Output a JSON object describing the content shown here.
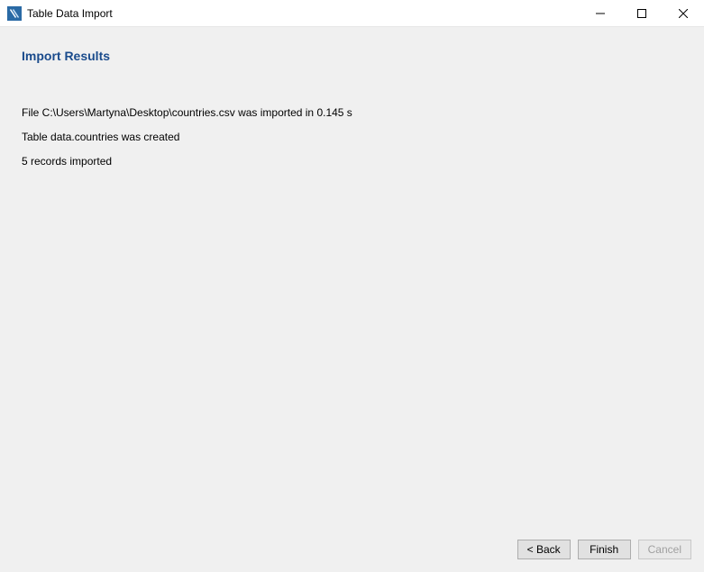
{
  "window": {
    "title": "Table Data Import"
  },
  "page": {
    "heading": "Import Results"
  },
  "results": {
    "line1": "File C:\\Users\\Martyna\\Desktop\\countries.csv was imported in 0.145 s",
    "line2": "Table data.countries was created",
    "line3": "5 records imported"
  },
  "footer": {
    "back_label": "< Back",
    "finish_label": "Finish",
    "cancel_label": "Cancel"
  }
}
